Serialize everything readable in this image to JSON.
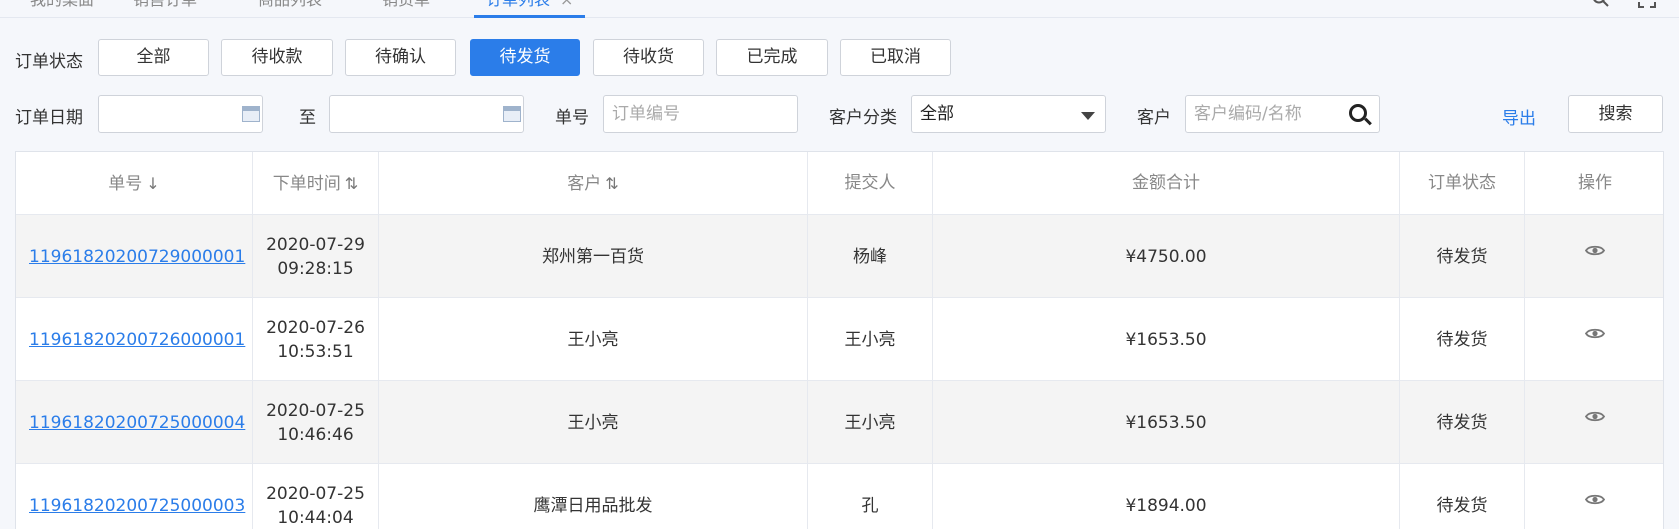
{
  "tabs": [
    {
      "label": "我的桌面"
    },
    {
      "label": "销售订单"
    },
    {
      "label": "商品列表"
    },
    {
      "label": "销货单"
    },
    {
      "label": "订单列表",
      "active": true,
      "close": "×"
    }
  ],
  "filters": {
    "status_label": "订单状态",
    "statuses": [
      "全部",
      "待收款",
      "待确认",
      "待发货",
      "待收货",
      "已完成",
      "已取消"
    ],
    "active_status": "待发货",
    "date_label": "订单日期",
    "date_to": "至",
    "order_no_label": "单号",
    "order_no_placeholder": "订单编号",
    "customer_category_label": "客户分类",
    "customer_category_value": "全部",
    "customer_label": "客户",
    "customer_placeholder": "客户编码/名称",
    "export_label": "导出",
    "search_label": "搜索"
  },
  "table": {
    "headers": {
      "order_no": "单号",
      "order_time": "下单时间",
      "customer": "客户",
      "submitter": "提交人",
      "amount": "金额合计",
      "status": "订单状态",
      "action": "操作"
    },
    "sort_icons": {
      "down": "↓",
      "both": "⇅"
    },
    "rows": [
      {
        "order_no": "11961820200729000001",
        "date": "2020-07-29",
        "time": "09:28:15",
        "customer": "郑州第一百货",
        "submitter": "杨峰",
        "amount": "¥4750.00",
        "status": "待发货"
      },
      {
        "order_no": "11961820200726000001",
        "date": "2020-07-26",
        "time": "10:53:51",
        "customer": "王小亮",
        "submitter": "王小亮",
        "amount": "¥1653.50",
        "status": "待发货"
      },
      {
        "order_no": "11961820200725000004",
        "date": "2020-07-25",
        "time": "10:46:46",
        "customer": "王小亮",
        "submitter": "王小亮",
        "amount": "¥1653.50",
        "status": "待发货"
      },
      {
        "order_no": "11961820200725000003",
        "date": "2020-07-25",
        "time": "10:44:04",
        "customer": "鹰潭日用品批发",
        "submitter": "孔",
        "amount": "¥1894.00",
        "status": "待发货"
      }
    ]
  },
  "icons": {
    "search": "search-icon",
    "fullscreen": "fullscreen-icon",
    "view": "eye-icon",
    "calendar": "calendar-icon"
  },
  "colors": {
    "accent": "#2b7de9",
    "row_stripe": "#f4f4f4"
  }
}
